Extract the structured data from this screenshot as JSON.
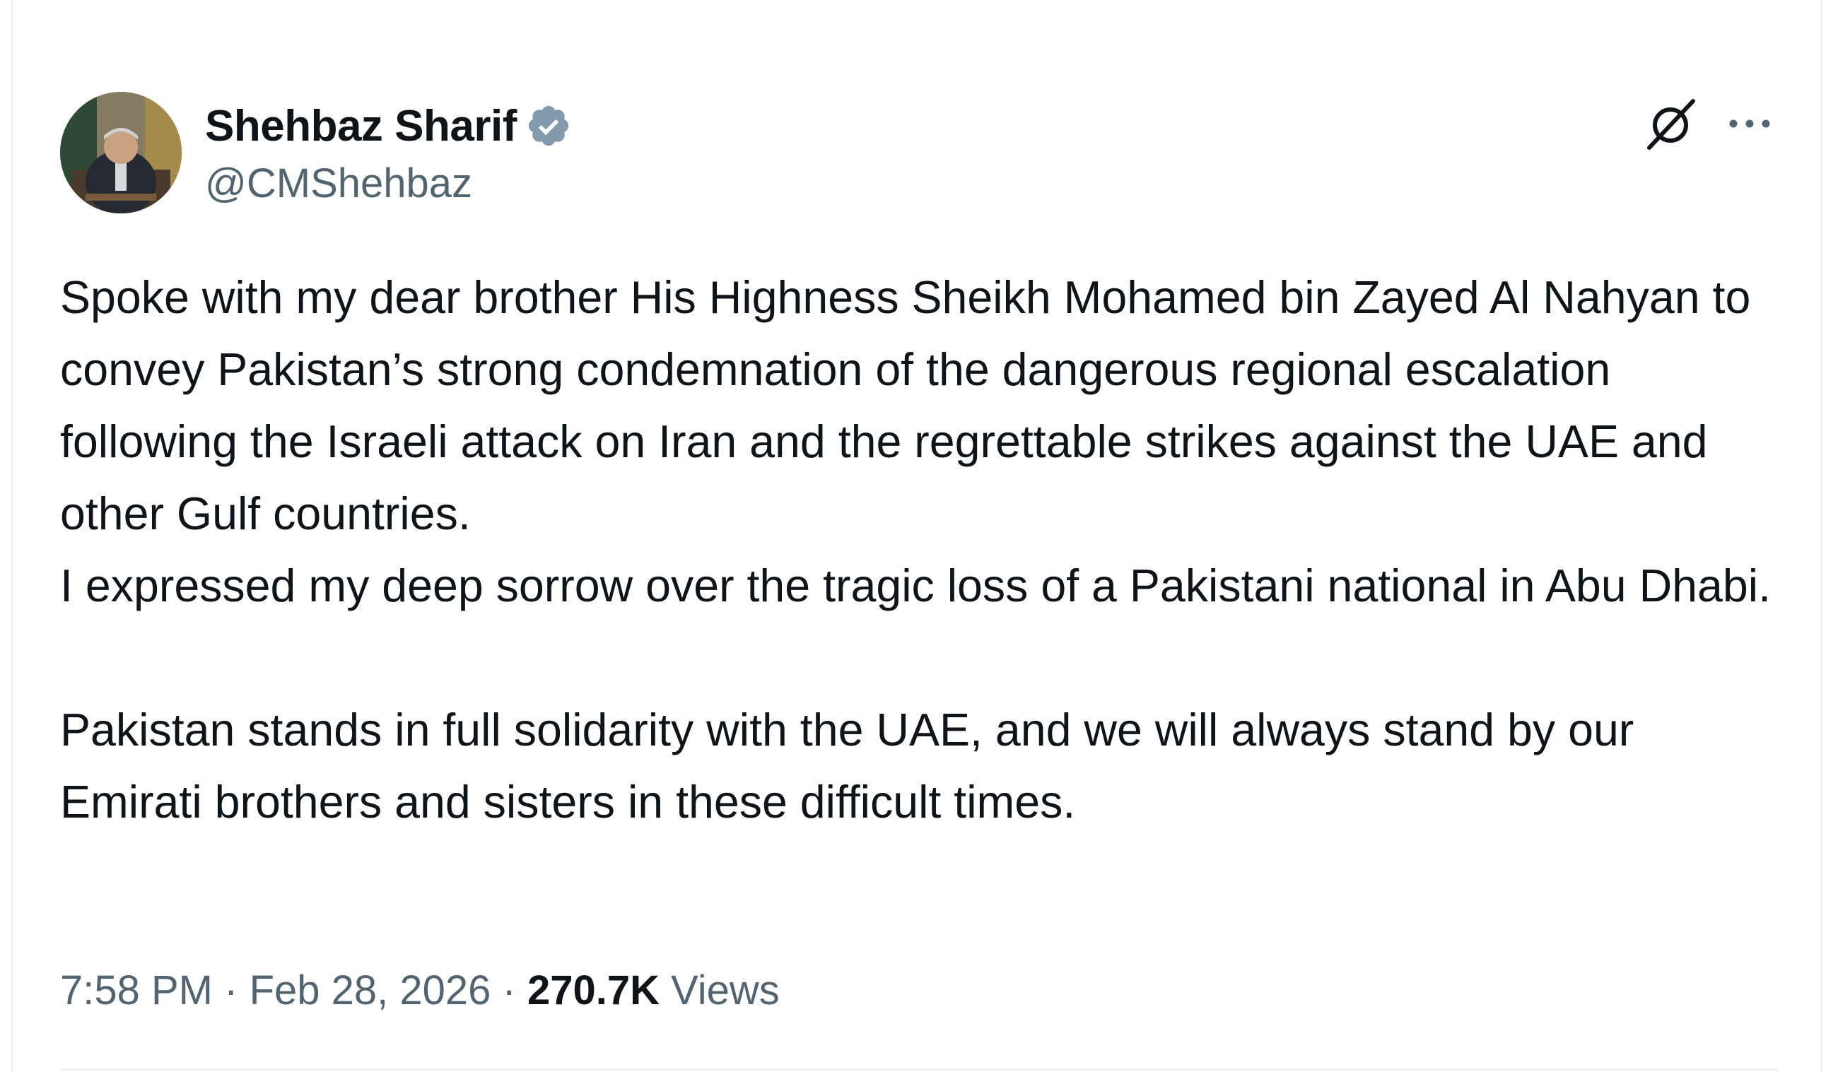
{
  "tweet": {
    "author": {
      "display_name": "Shehbaz Sharif",
      "handle": "@CMShehbaz",
      "verified": true
    },
    "body": {
      "paragraph_1": "Spoke with my dear brother His Highness Sheikh Mohamed bin Zayed Al Nahyan to convey Pakistan’s strong condemnation of the dangerous regional escalation following the Israeli attack on Iran and the regrettable strikes against the UAE and other Gulf countries.",
      "paragraph_2": "I expressed my deep sorrow over the tragic loss of a Pakistani national in Abu Dhabi.",
      "paragraph_3": "Pakistan stands in full solidarity with the UAE, and we will always stand by our Emirati brothers and sisters in these difficult times."
    },
    "meta": {
      "time": "7:58 PM",
      "separator": "·",
      "date": "Feb 28, 2026",
      "views_count": "270.7K",
      "views_label": "Views"
    },
    "icons": {
      "verified": "verified-badge-icon",
      "grok": "grok-icon",
      "more": "more-options-icon"
    },
    "colors": {
      "text": "#0f1419",
      "secondary": "#536471",
      "verified_badge": "#829aab"
    }
  }
}
